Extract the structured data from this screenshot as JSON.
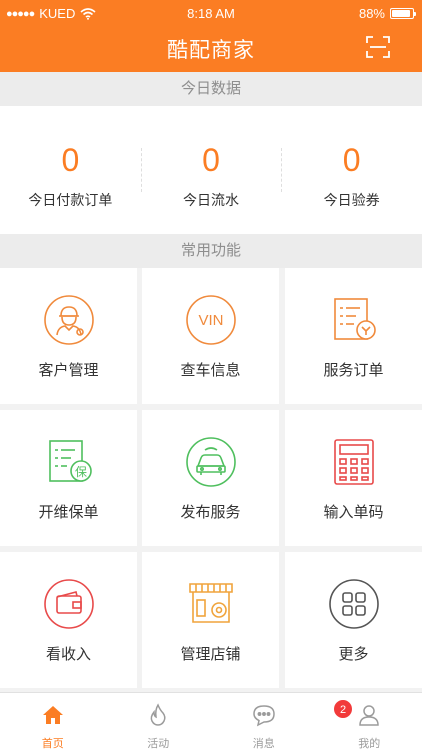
{
  "status_bar": {
    "carrier": "KUED",
    "time": "8:18 AM",
    "battery_text": "88%",
    "battery_level": 0.88
  },
  "nav": {
    "title": "酷配商家",
    "scan_icon": "scan-icon"
  },
  "today": {
    "header": "今日数据",
    "stats": [
      {
        "value": "0",
        "label": "今日付款订单"
      },
      {
        "value": "0",
        "label": "今日流水"
      },
      {
        "value": "0",
        "label": "今日验券"
      }
    ]
  },
  "functions": {
    "header": "常用功能",
    "items": [
      {
        "label": "客户管理",
        "icon": "customer-icon",
        "color": "#f08a3c"
      },
      {
        "label": "查车信息",
        "icon": "vin-icon",
        "color": "#f08a3c",
        "icon_text": "VIN"
      },
      {
        "label": "服务订单",
        "icon": "service-order-icon",
        "color": "#f08a3c"
      },
      {
        "label": "开维保单",
        "icon": "maintenance-order-icon",
        "color": "#4fbf5e",
        "icon_text": "保"
      },
      {
        "label": "发布服务",
        "icon": "car-service-icon",
        "color": "#4fbf5e"
      },
      {
        "label": "输入单码",
        "icon": "keypad-icon",
        "color": "#e84a4a"
      },
      {
        "label": "看收入",
        "icon": "wallet-icon",
        "color": "#e84a4a"
      },
      {
        "label": "管理店铺",
        "icon": "store-settings-icon",
        "color": "#f0a43c"
      },
      {
        "label": "更多",
        "icon": "more-icon",
        "color": "#555555"
      }
    ]
  },
  "tabs": [
    {
      "label": "首页",
      "icon": "home-icon",
      "active": true
    },
    {
      "label": "活动",
      "icon": "flame-icon",
      "active": false
    },
    {
      "label": "消息",
      "icon": "message-icon",
      "active": false,
      "badge": "2"
    },
    {
      "label": "我的",
      "icon": "profile-icon",
      "active": false
    }
  ],
  "colors": {
    "accent": "#fb7d23",
    "background": "#f2f2f2"
  }
}
